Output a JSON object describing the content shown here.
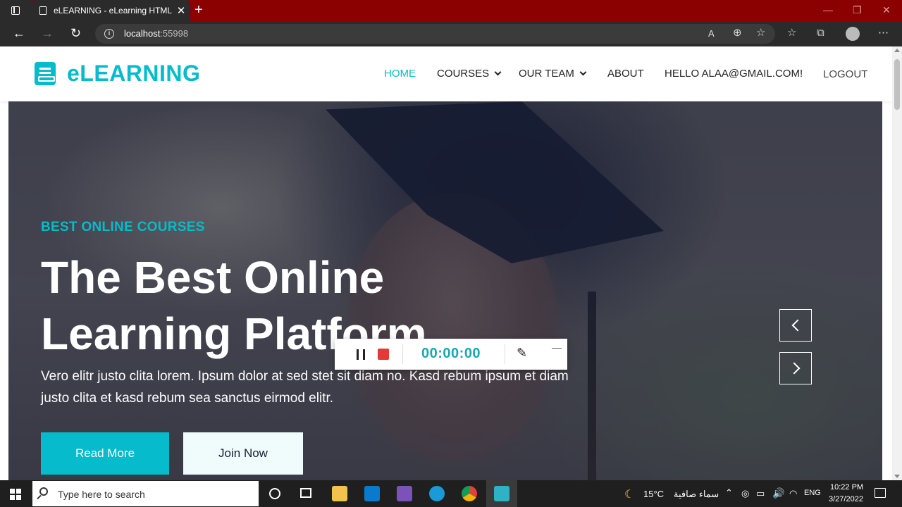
{
  "browser": {
    "tab_title": "eLEARNING - eLearning HTML Te",
    "url_host": "localhost",
    "url_port": ":55998",
    "new_tab_symbol": "+",
    "tab_close_symbol": "✕"
  },
  "site": {
    "brand": "eLEARNING",
    "nav": {
      "home": "HOME",
      "courses": "COURSES",
      "our_team": "OUR TEAM",
      "about": "ABOUT",
      "greeting": "HELLO ALAA@GMAIL.COM!",
      "logout": "LOGOUT"
    }
  },
  "hero": {
    "subtitle": "BEST ONLINE COURSES",
    "title": "The Best Online Learning Platform",
    "text": "Vero elitr justo clita lorem. Ipsum dolor at sed stet sit diam no. Kasd rebum ipsum et diam justo clita et kasd rebum sea sanctus eirmod elitr.",
    "read_more": "Read More",
    "join_now": "Join Now"
  },
  "recorder": {
    "time": "00:00:00"
  },
  "taskbar": {
    "search_placeholder": "Type here to search",
    "weather_temp": "15°C",
    "weather_text": "سماء صافية",
    "language": "ENG",
    "time": "10:22 PM",
    "date": "3/27/2022"
  },
  "colors": {
    "accent": "#06bbcc",
    "dark": "#181d38",
    "tabbar": "#8b0000"
  }
}
